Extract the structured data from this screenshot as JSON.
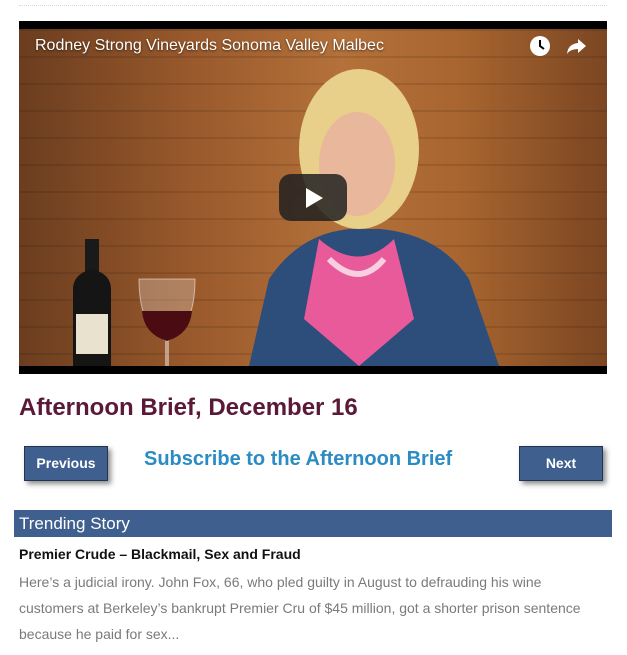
{
  "video": {
    "title": "Rodney Strong Vineyards Sonoma Valley Malbec",
    "icons": [
      "watch-later-icon",
      "share-icon",
      "play-icon"
    ]
  },
  "brief": {
    "title": "Afternoon Brief, December 16",
    "previous_label": "Previous",
    "next_label": "Next",
    "subscribe_label": "Subscribe to the Afternoon Brief"
  },
  "trending": {
    "header": "Trending Story",
    "story_title": "Premier Crude – Blackmail, Sex and Fraud",
    "story_excerpt": "Here’s a judicial irony. John Fox, 66, who pled guilty in August to defrauding his wine customers at Berkeley’s bankrupt Premier Cru of $45 million, got a shorter prison sentence because he paid for sex..."
  },
  "colors": {
    "title": "#5a1a37",
    "button_bg": "#3f5f8f",
    "link": "#2b8cc4",
    "excerpt": "#7a7a7a"
  }
}
